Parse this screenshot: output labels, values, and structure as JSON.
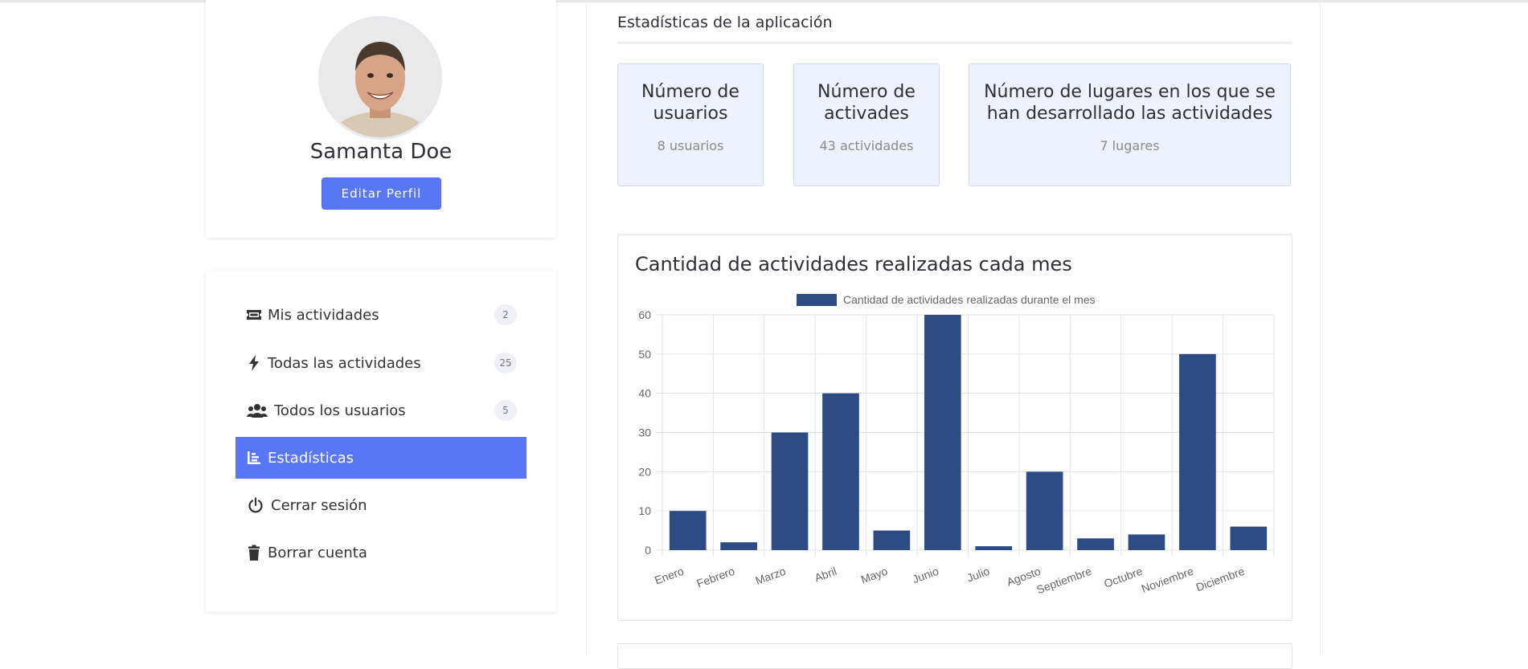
{
  "profile": {
    "name": "Samanta Doe",
    "edit_button": "Editar Perfil"
  },
  "menu": {
    "items": [
      {
        "label": "Mis actividades",
        "icon": "ticket-icon",
        "badge": "2",
        "active": false
      },
      {
        "label": "Todas las actividades",
        "icon": "bolt-icon",
        "badge": "25",
        "active": false
      },
      {
        "label": "Todos los usuarios",
        "icon": "users-icon",
        "badge": "5",
        "active": false
      },
      {
        "label": "Estadísticas",
        "icon": "chart-bar-icon",
        "badge": null,
        "active": true
      },
      {
        "label": "Cerrar sesión",
        "icon": "power-icon",
        "badge": null,
        "active": false
      },
      {
        "label": "Borrar cuenta",
        "icon": "trash-icon",
        "badge": null,
        "active": false
      }
    ]
  },
  "stats": {
    "title": "Estadísticas de la aplicación",
    "boxes": [
      {
        "title_l1": "Número de",
        "title_l2": "usuarios",
        "value": "8 usuarios"
      },
      {
        "title_l1": "Número de",
        "title_l2": "activades",
        "value": "43 actividades"
      },
      {
        "title_l1": "Número de lugares en los que se",
        "title_l2": "han desarrollado las actividades",
        "value": "7 lugares"
      }
    ]
  },
  "colors": {
    "accent": "#5877f6",
    "bar": "#2d4b84",
    "stat_bg": "#eef2fe"
  },
  "chart_data": {
    "type": "bar",
    "title": "Cantidad de actividades realizadas cada mes",
    "categories": [
      "Enero",
      "Febrero",
      "Marzo",
      "Abril",
      "Mayo",
      "Junio",
      "Julio",
      "Agosto",
      "Septiembre",
      "Octubre",
      "Noviembre",
      "Diciembre"
    ],
    "series": [
      {
        "name": "Cantidad de actividades realizadas durante el mes",
        "values": [
          10,
          2,
          30,
          40,
          5,
          60,
          1,
          20,
          3,
          4,
          50,
          6
        ]
      }
    ],
    "ylim": [
      0,
      60
    ],
    "yticks": [
      0,
      10,
      20,
      30,
      40,
      50,
      60
    ],
    "grid": true,
    "legend": "top-center"
  }
}
